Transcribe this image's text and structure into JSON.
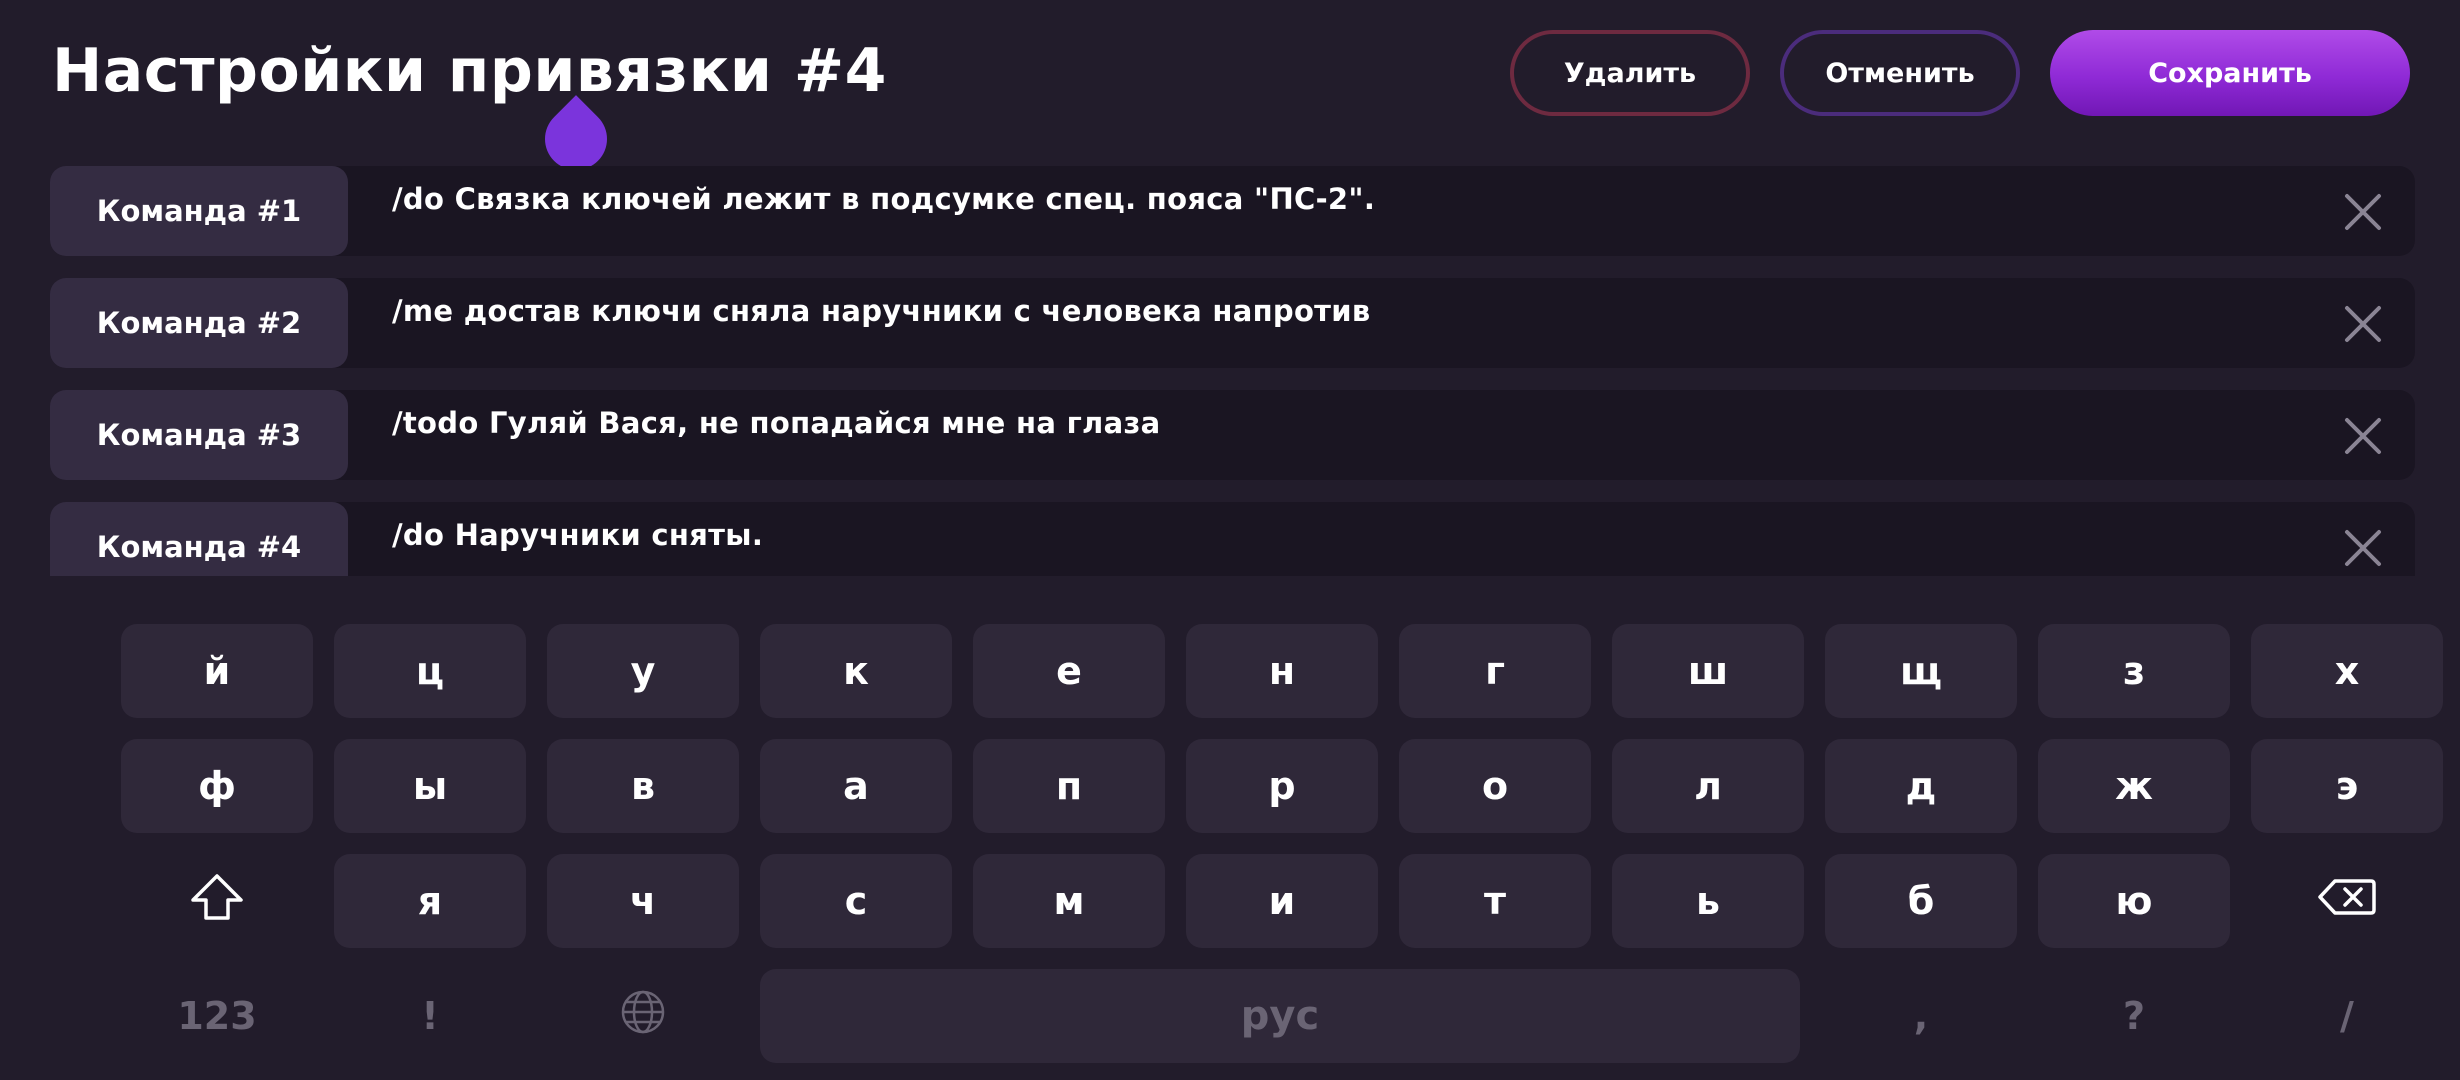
{
  "header": {
    "title": "Настройки привязки #4",
    "delete_label": "Удалить",
    "cancel_label": "Отменить",
    "save_label": "Сохранить"
  },
  "colors": {
    "background": "#221c2b",
    "accent": "#8f2ad6",
    "delete_border": "#6e2a40",
    "cancel_border": "#4b2c7c",
    "cursor_handle": "#7b34dc"
  },
  "commands": [
    {
      "label": "Команда #1",
      "text": "/do Связка ключей лежит в подсумке спец. пояса \"ПС-2\"."
    },
    {
      "label": "Команда #2",
      "text": "/me достав ключи сняла наручники с человека напротив"
    },
    {
      "label": "Команда #3",
      "text": "/todo Гуляй Вася, не попадайся мне на глаза"
    },
    {
      "label": "Команда #4",
      "text": "/do Наручники сняты."
    }
  ],
  "keyboard": {
    "row1": [
      "й",
      "ц",
      "у",
      "к",
      "е",
      "н",
      "г",
      "ш",
      "щ",
      "з",
      "х"
    ],
    "row2": [
      "ф",
      "ы",
      "в",
      "а",
      "п",
      "р",
      "о",
      "л",
      "д",
      "ж",
      "э"
    ],
    "row3": [
      "я",
      "ч",
      "с",
      "м",
      "и",
      "т",
      "ь",
      "б",
      "ю"
    ],
    "numbers_label": "123",
    "exclamation": "!",
    "space_label": "рус",
    "comma": ",",
    "question": "?",
    "slash": "/"
  },
  "icons": {
    "close": "close-icon",
    "shift": "shift-icon",
    "backspace": "backspace-icon",
    "language": "globe-icon"
  }
}
